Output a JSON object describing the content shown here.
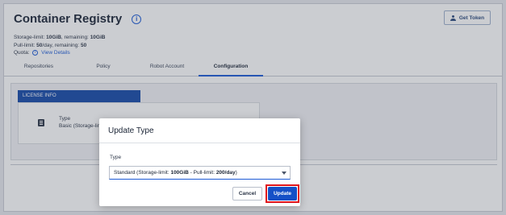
{
  "header": {
    "title": "Container Registry",
    "get_token_label": "Get Token"
  },
  "meta": {
    "storage_prefix": "Storage-limit: ",
    "storage_limit": "10GiB",
    "storage_mid": ", remaining: ",
    "storage_remaining": "10GiB",
    "pull_prefix": "Pull-limit: ",
    "pull_limit": "50",
    "pull_mid": "/day, remaining: ",
    "pull_remaining": "50",
    "quota_label": "Quota:",
    "view_details": "View Details"
  },
  "tabs": [
    {
      "label": "Repositories"
    },
    {
      "label": "Policy"
    },
    {
      "label": "Robot Account"
    },
    {
      "label": "Configuration"
    }
  ],
  "license": {
    "header": "LICENSE INFO",
    "type_label": "Type",
    "type_value": "Basic (Storage-limit"
  },
  "modal": {
    "title": "Update Type",
    "field_label": "Type",
    "select": {
      "prefix": "Standard (Storage-limit: ",
      "storage": "100GiB",
      "mid": " - Pull-limit: ",
      "pull": "200/day",
      "suffix": ")"
    },
    "cancel_label": "Cancel",
    "update_label": "Update"
  }
}
